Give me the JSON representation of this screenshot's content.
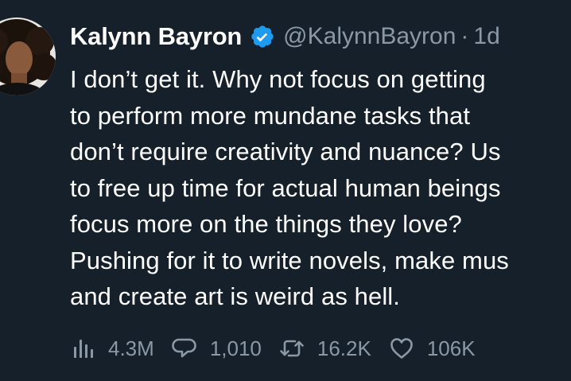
{
  "tweet": {
    "author_name": "Kalynn Bayron",
    "handle": "@KalynnBayron",
    "separator": "·",
    "time": "1d",
    "verified": true,
    "text_lines": [
      "I don’t get it. Why not focus on getting",
      "to perform more mundane tasks that",
      "don’t require creativity and nuance? Us",
      "to free up time for actual human beings",
      "focus more on the things they love?",
      "Pushing for it to write novels, make mus",
      "and create art is weird as hell."
    ]
  },
  "actions": {
    "views": "4.3M",
    "replies": "1,010",
    "retweets": "16.2K",
    "likes": "106K"
  },
  "icons": {
    "views": "analytics-icon",
    "replies": "reply-icon",
    "retweets": "retweet-icon",
    "likes": "heart-icon",
    "verified": "verified-badge-icon"
  },
  "colors": {
    "background": "#15202b",
    "text": "#ffffff",
    "secondary": "#8b98a5",
    "verified": "#1d9bf0"
  }
}
